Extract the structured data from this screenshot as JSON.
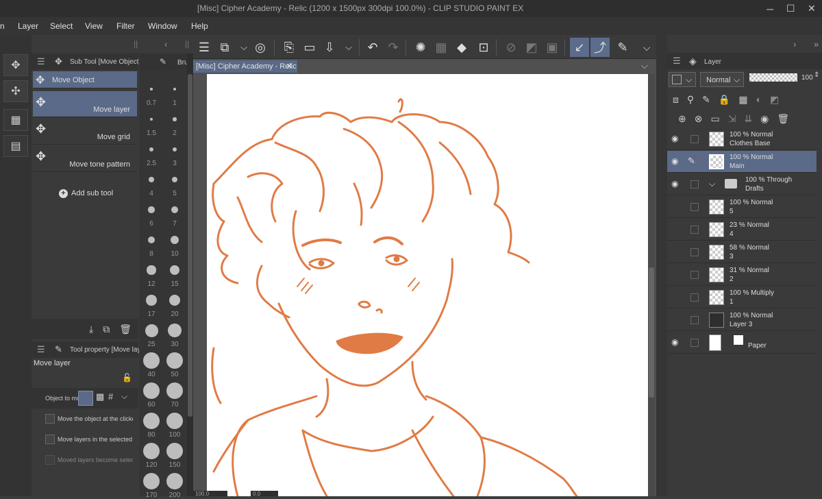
{
  "window": {
    "title": "[Misc] Cipher Academy - Relic (1200 x 1500px 300dpi 100.0%)  - CLIP STUDIO PAINT EX",
    "minimize": "─",
    "maximize": "☐",
    "close": "✕"
  },
  "menu": {
    "items": [
      "n",
      "Layer",
      "Select",
      "View",
      "Filter",
      "Window",
      "Help"
    ]
  },
  "subtool_panel": {
    "title": "Sub Tool [Move Object]",
    "group": "Move Object",
    "items": [
      "Move layer",
      "Move grid",
      "Move tone pattern"
    ],
    "add": "Add sub tool"
  },
  "brush_panel": {
    "title": "Brus",
    "sizes": [
      "0.7",
      "1",
      "1.5",
      "2",
      "2.5",
      "3",
      "4",
      "5",
      "6",
      "7",
      "8",
      "10",
      "12",
      "15",
      "17",
      "20",
      "25",
      "30",
      "40",
      "50",
      "60",
      "70",
      "80",
      "100",
      "120",
      "150",
      "170",
      "200"
    ]
  },
  "tool_property": {
    "title": "Tool property [Move laye",
    "tool": "Move layer",
    "object_label": "Object to mov",
    "options": [
      "Move the object at the clicked po",
      "Move layers in the selected area",
      "Moved layers become selected"
    ]
  },
  "document": {
    "tab": "[Misc] Cipher Academy - Relic",
    "close": "✕",
    "footer_left": "100.0",
    "footer_mid": "0.0"
  },
  "layer_panel": {
    "title": "Layer",
    "blend": "Normal",
    "opacity": "100",
    "layers": [
      {
        "opacity_mode": "100 % Normal",
        "name": "Clothes Base",
        "visible": true
      },
      {
        "opacity_mode": "100 % Normal",
        "name": "Main",
        "visible": true,
        "selected": true
      },
      {
        "opacity_mode": "100 % Through",
        "name": "Drafts",
        "visible": true,
        "folder": true
      },
      {
        "opacity_mode": "100 % Normal",
        "name": "5",
        "visible": false
      },
      {
        "opacity_mode": "23 % Normal",
        "name": "4",
        "visible": false
      },
      {
        "opacity_mode": "58 % Normal",
        "name": "3",
        "visible": false
      },
      {
        "opacity_mode": "31 % Normal",
        "name": "2",
        "visible": false
      },
      {
        "opacity_mode": "100 % Multiply",
        "name": "1",
        "visible": false
      },
      {
        "opacity_mode": "100 % Normal",
        "name": "Layer 3",
        "visible": false
      },
      {
        "opacity_mode": "",
        "name": "Paper",
        "visible": true
      }
    ]
  },
  "colors": {
    "accent": "#5a6a88",
    "line_art": "#e07b45"
  }
}
